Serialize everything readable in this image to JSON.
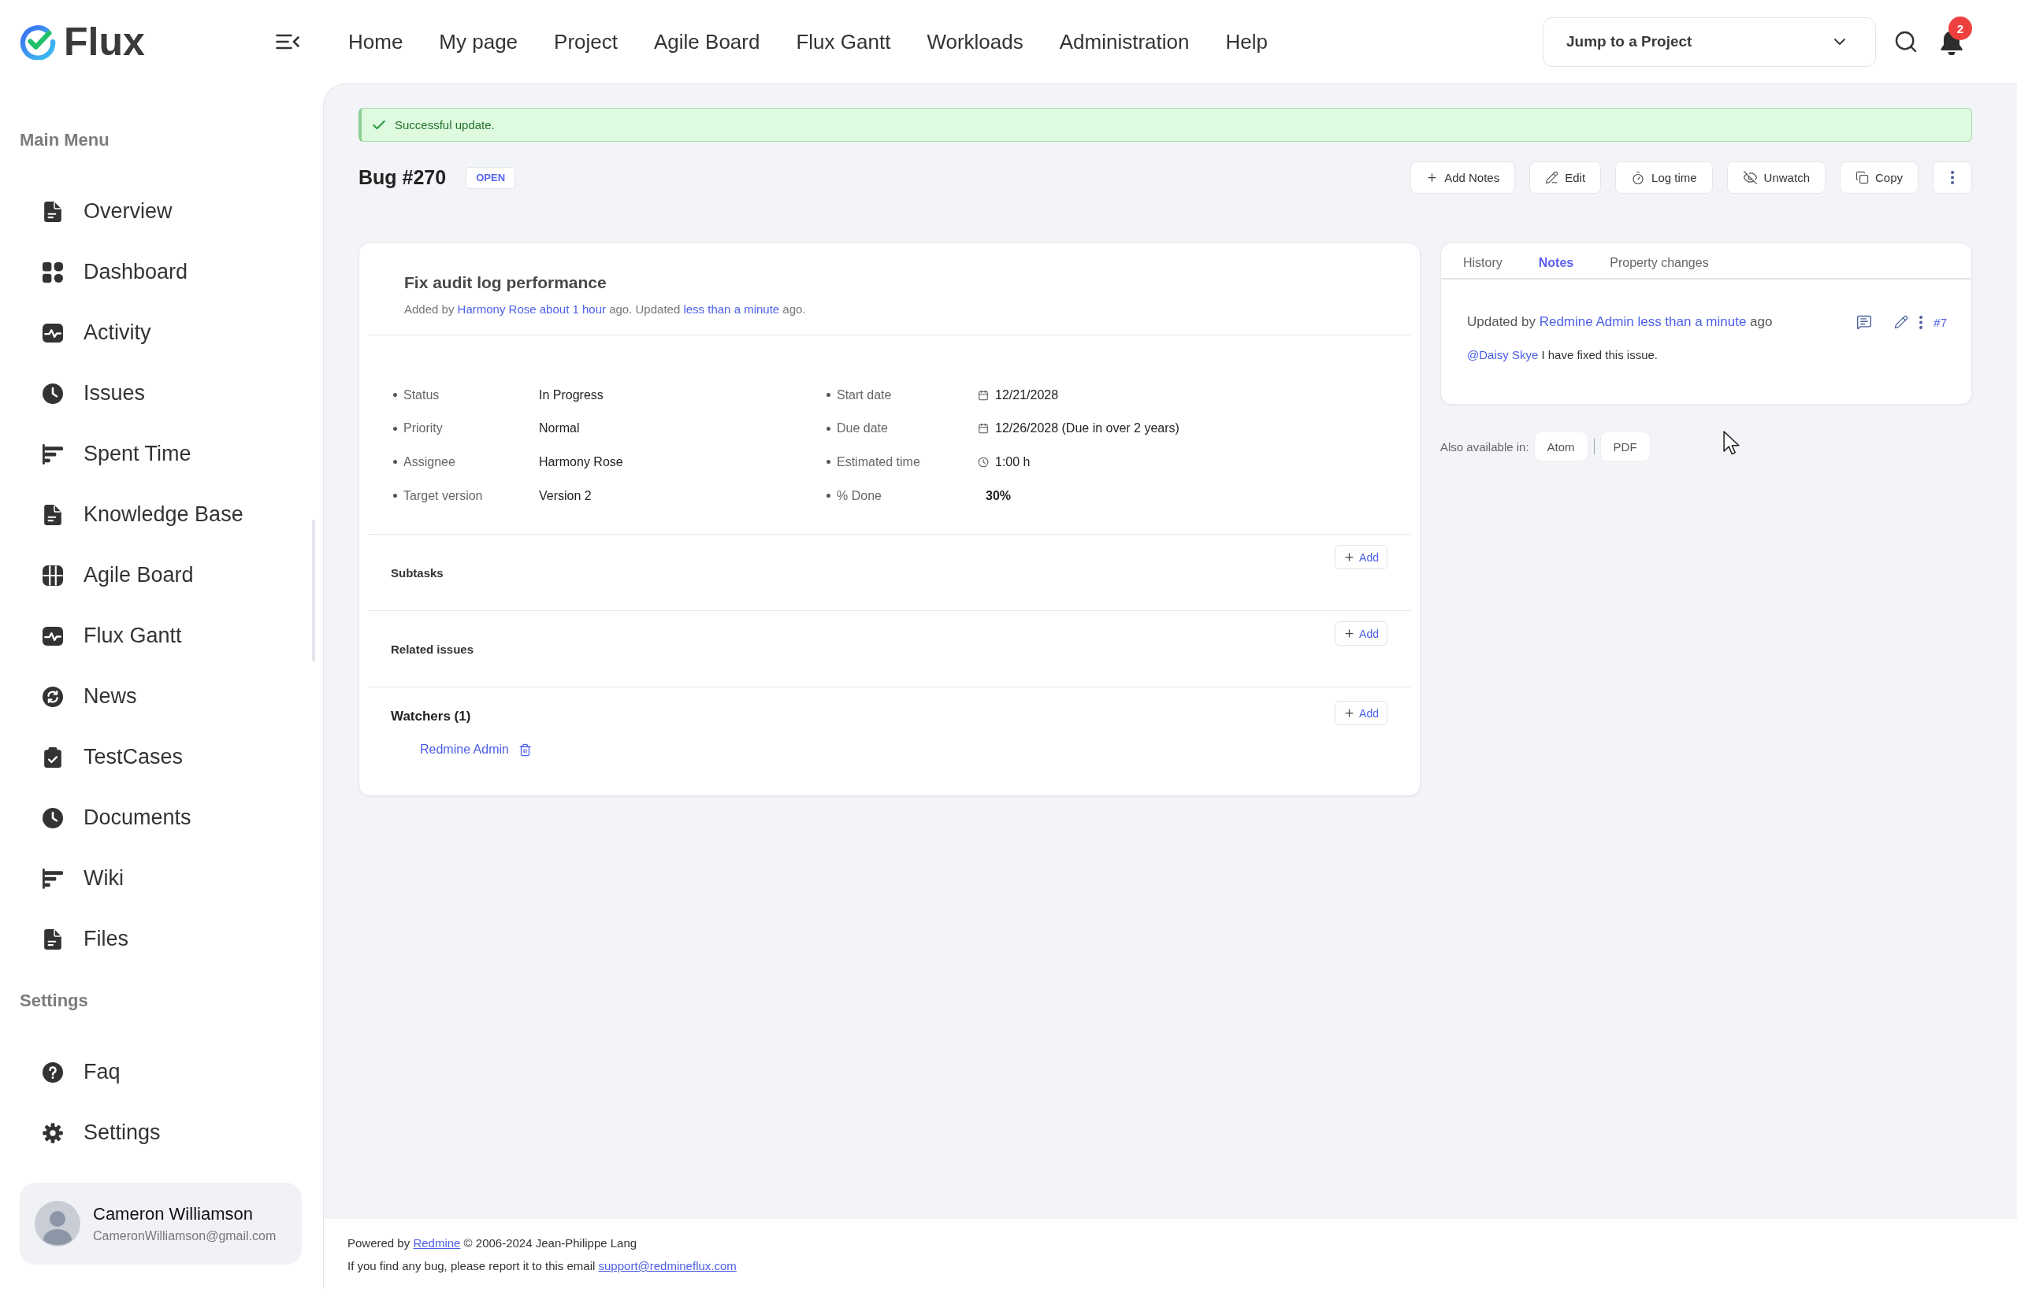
{
  "brand": {
    "name": "Flux"
  },
  "top_nav": [
    "Home",
    "My page",
    "Project",
    "Agile Board",
    "Flux Gantt",
    "Workloads",
    "Administration",
    "Help"
  ],
  "project_jump": {
    "label": "Jump to a Project"
  },
  "notifications": {
    "count": "2"
  },
  "sidebar": {
    "sections": [
      {
        "heading": "Main Menu",
        "items": [
          "Overview",
          "Dashboard",
          "Activity",
          "Issues",
          "Spent Time",
          "Knowledge Base",
          "Agile Board",
          "Flux Gantt",
          "News",
          "TestCases",
          "Documents",
          "Wiki",
          "Files"
        ]
      },
      {
        "heading": "Settings",
        "items": [
          "Faq",
          "Settings"
        ]
      }
    ]
  },
  "user": {
    "name": "Cameron Williamson",
    "email": "CameronWilliamson@gmail.com"
  },
  "flash": {
    "kind": "success",
    "text": "Successful update."
  },
  "issue": {
    "title": "Bug #270",
    "status": "OPEN"
  },
  "actions": [
    "Add Notes",
    "Edit",
    "Log time",
    "Unwatch",
    "Copy"
  ],
  "details": {
    "subject": "Fix audit log performance",
    "byline": [
      {
        "kind": "text",
        "text": "Added by "
      },
      {
        "kind": "link",
        "text": "Harmony Rose about 1 hour"
      },
      {
        "kind": "text",
        "text": " ago. Updated "
      },
      {
        "kind": "link",
        "text": "less than a minute"
      },
      {
        "kind": "text",
        "text": " ago."
      }
    ],
    "attributes": [
      [
        {
          "kind": "text",
          "label": "Status",
          "value": "In Progress"
        },
        {
          "kind": "text",
          "label": "Priority",
          "value": "Normal"
        },
        {
          "kind": "text",
          "label": "Assignee",
          "value": "Harmony Rose"
        },
        {
          "kind": "text",
          "label": "Target version",
          "value": "Version 2"
        }
      ],
      [
        {
          "kind": "date",
          "label": "Start date",
          "value": "12/21/2028"
        },
        {
          "kind": "date",
          "label": "Due date",
          "value": "12/26/2028 (Due in over 2 years)"
        },
        {
          "kind": "duration",
          "label": "Estimated time",
          "value": "1:00 h"
        },
        {
          "kind": "percent",
          "label": "% Done",
          "value": "30%"
        }
      ]
    ],
    "sections": [
      {
        "title": "Subtasks",
        "add_label": "Add"
      },
      {
        "title": "Related issues",
        "add_label": "Add"
      },
      {
        "title": "Watchers (1)",
        "add_label": "Add",
        "watchers": [
          "Redmine Admin"
        ]
      }
    ]
  },
  "history": {
    "tabs": [
      {
        "label": "History",
        "selected": false
      },
      {
        "label": "Notes",
        "selected": true
      },
      {
        "label": "Property changes",
        "selected": false
      }
    ],
    "journal": {
      "byline": [
        {
          "kind": "text",
          "text": "Updated by "
        },
        {
          "kind": "link",
          "text": "Redmine Admin less than a minute"
        },
        {
          "kind": "text",
          "text": " ago"
        }
      ],
      "number": "#7",
      "note": [
        {
          "kind": "link",
          "text": "@Daisy Skye"
        },
        {
          "kind": "text",
          "text": " I have fixed this issue."
        }
      ]
    }
  },
  "exports": {
    "label": "Also available in:",
    "formats": [
      "Atom",
      "PDF"
    ]
  },
  "footer": {
    "lines": [
      [
        {
          "kind": "text",
          "text": "Powered by "
        },
        {
          "kind": "link",
          "text": "Redmine"
        },
        {
          "kind": "text",
          "text": " © 2006-2024 Jean-Philippe Lang"
        }
      ],
      [
        {
          "kind": "text",
          "text": "If you find any bug, please report it to this email "
        },
        {
          "kind": "link",
          "text": "support@redmineflux.com"
        }
      ]
    ]
  }
}
